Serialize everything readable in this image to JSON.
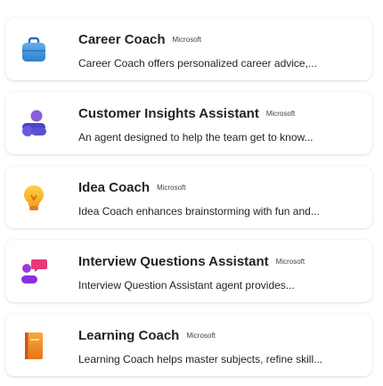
{
  "agents": [
    {
      "title": "Career Coach",
      "publisher": "Microsoft",
      "description": "Career Coach offers personalized career advice,...",
      "icon": "briefcase-icon"
    },
    {
      "title": "Customer Insights Assistant",
      "publisher": "Microsoft",
      "description": "An agent designed to help the team get to know...",
      "icon": "people-icon"
    },
    {
      "title": "Idea Coach",
      "publisher": "Microsoft",
      "description": "Idea Coach enhances brainstorming with fun and...",
      "icon": "lightbulb-icon"
    },
    {
      "title": "Interview Questions Assistant",
      "publisher": "Microsoft",
      "description": "Interview Question Assistant agent provides...",
      "icon": "chat-people-icon"
    },
    {
      "title": "Learning Coach",
      "publisher": "Microsoft",
      "description": "Learning Coach helps master subjects, refine skill...",
      "icon": "book-icon"
    }
  ]
}
